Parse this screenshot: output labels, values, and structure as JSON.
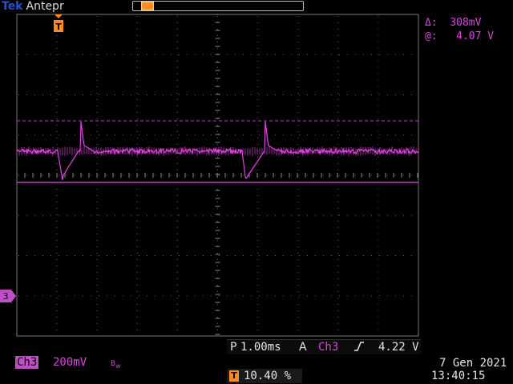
{
  "header": {
    "brand": "Tek",
    "mode": "Antepr"
  },
  "measurement": {
    "delta_label": "Δ:",
    "delta_value": "308mV",
    "at_label": "@:",
    "at_value": "4.07 V"
  },
  "channel": {
    "marker": "3",
    "name": "Ch3",
    "scale": "200mV",
    "bw_icon": "bandwidth-limit-icon"
  },
  "timebase": {
    "prefix": "P",
    "value": "1.00ms",
    "trigger_mode": "A",
    "trigger_source": "Ch3",
    "trigger_slope": "rising-edge-icon",
    "trigger_level": "4.22 V"
  },
  "position": {
    "icon": "T",
    "value": "10.40 %"
  },
  "datetime": {
    "date": "7 Gen  2021",
    "time": "13:40:15"
  },
  "colors": {
    "trace": "#e83fe8",
    "trigger": "#ff8c1a",
    "grid": "#6b6b6b"
  }
}
